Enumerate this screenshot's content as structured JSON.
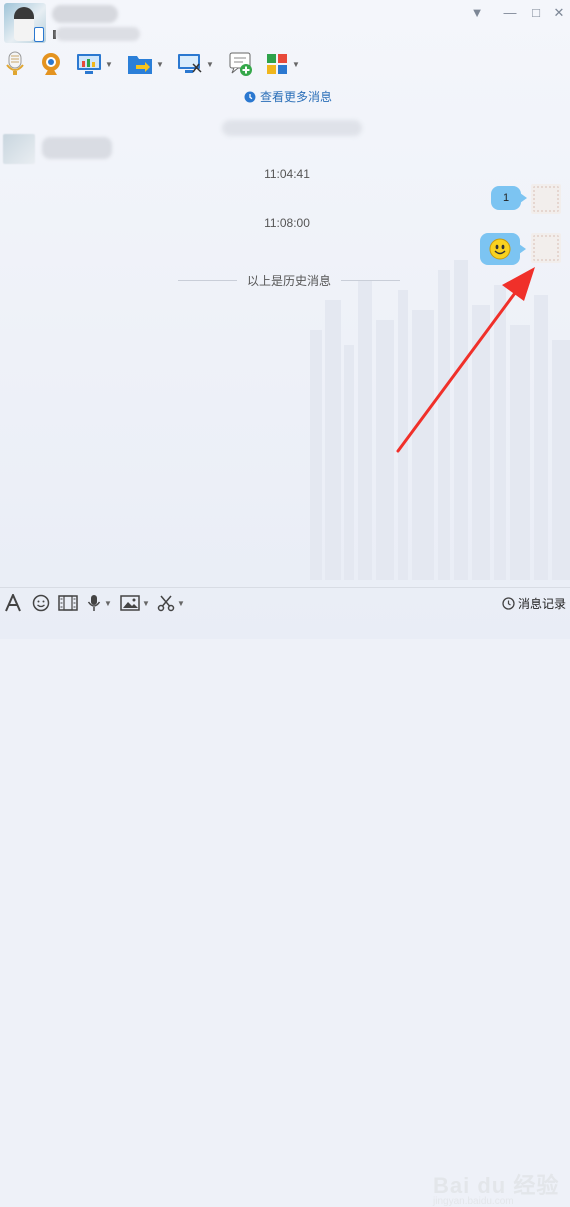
{
  "messages": {
    "view_more": "查看更多消息",
    "time1": "11:04:41",
    "sent1_text": "1",
    "time2": "11:08:00",
    "history_label": "以上是历史消息"
  },
  "input_toolbar": {
    "history_label": "消息记录"
  },
  "watermark": {
    "brand": "Bai du 经验",
    "url": "jingyan.baidu.com"
  },
  "colors": {
    "bubble": "#7cc4f2",
    "link": "#2b6fb8",
    "arrow": "#f0302a",
    "background": "#eef1f8"
  },
  "icons": {
    "toolbar": [
      "microphone-icon",
      "webcam-icon",
      "screen-share-icon",
      "send-file-icon",
      "remote-desktop-icon",
      "chat-add-icon",
      "apps-grid-icon"
    ],
    "input": [
      "font-icon",
      "smiley-icon",
      "film-icon",
      "microphone-icon",
      "image-icon",
      "scissors-icon",
      "history-clock-icon"
    ],
    "window": [
      "dropdown-menu-icon",
      "minimize-icon",
      "maximize-icon",
      "close-icon"
    ]
  }
}
